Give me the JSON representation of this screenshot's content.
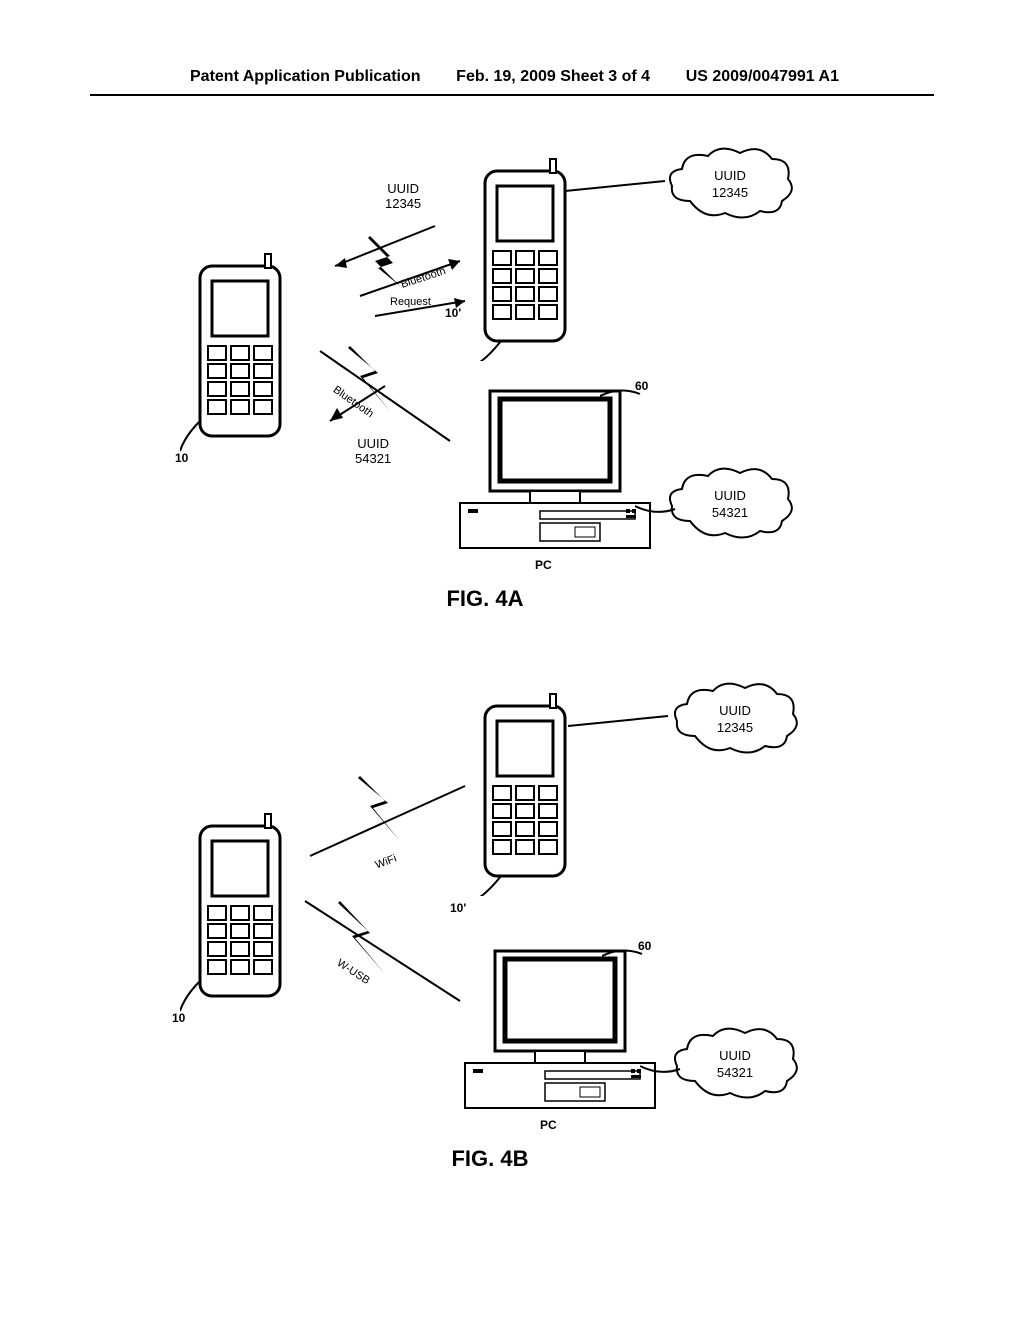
{
  "header": {
    "left": "Patent Application Publication",
    "center": "Feb. 19, 2009  Sheet 3 of 4",
    "right": "US 2009/0047991 A1"
  },
  "fig4a": {
    "label": "FIG. 4A",
    "uuid_top": "UUID\n12345",
    "uuid_cloud1": {
      "l1": "UUID",
      "l2": "12345"
    },
    "uuid_cloud2": {
      "l1": "UUID",
      "l2": "54321"
    },
    "uuid_bottom": "UUID\n54321",
    "bluetooth1": "Bluetooth",
    "bluetooth2": "Bluetooth",
    "request": "Request",
    "ref10": "10",
    "ref10p": "10'",
    "ref60": "60",
    "pc": "PC"
  },
  "fig4b": {
    "label": "FIG. 4B",
    "uuid_cloud1": {
      "l1": "UUID",
      "l2": "12345"
    },
    "uuid_cloud2": {
      "l1": "UUID",
      "l2": "54321"
    },
    "wifi": "WiFi",
    "wusb": "W-USB",
    "ref10": "10",
    "ref10p": "10'",
    "ref60": "60",
    "pc": "PC"
  }
}
